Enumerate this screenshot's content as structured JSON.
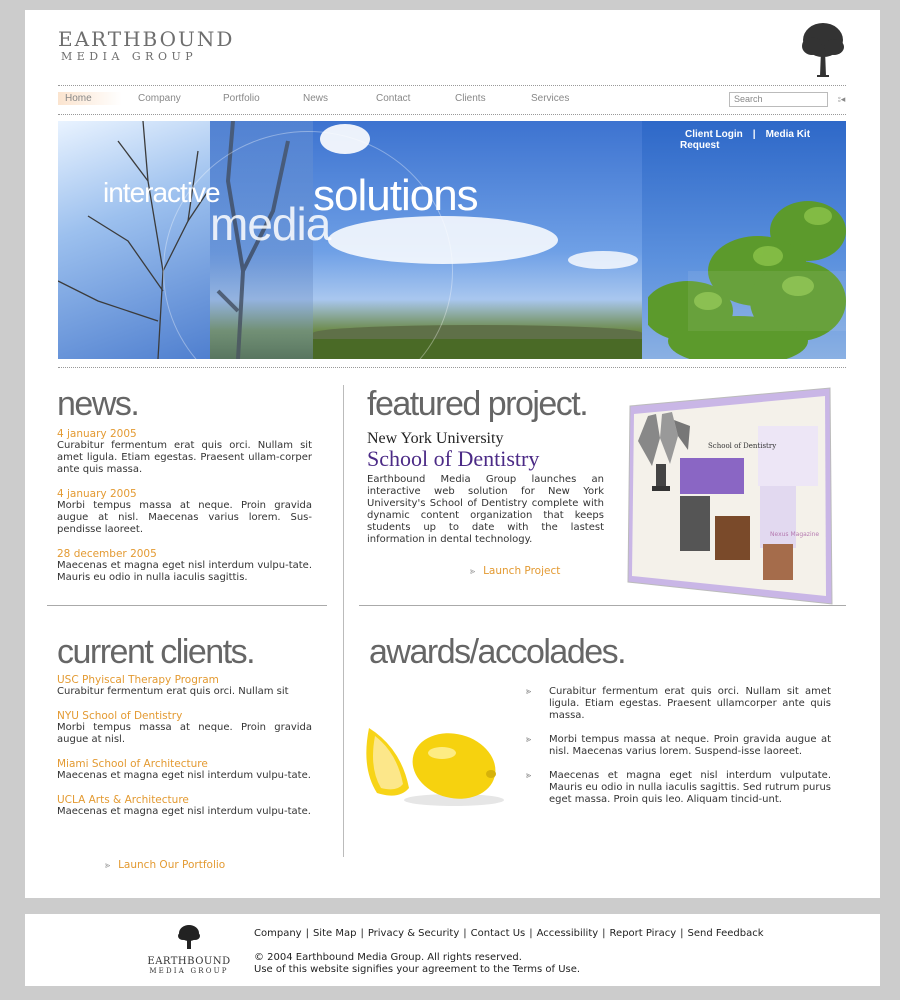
{
  "brand": {
    "line1": "EARTHBOUND",
    "line2": "MEDIA GROUP"
  },
  "nav": {
    "items": [
      "Home",
      "Company",
      "Portfolio",
      "News",
      "Contact",
      "Clients",
      "Services"
    ],
    "search_placeholder": "Search"
  },
  "hero": {
    "word1": "interactive",
    "word2": "media",
    "word3": "solutions",
    "client_login": "Client Login",
    "separator": "|",
    "media_kit": "Media Kit Request"
  },
  "news": {
    "title": "news.",
    "items": [
      {
        "date": "4 january 2005",
        "text": "Curabitur fermentum erat quis orci. Nullam sit amet ligula. Etiam egestas. Praesent ullam-corper ante quis massa."
      },
      {
        "date": "4 january 2005",
        "text": "Morbi tempus massa at neque. Proin gravida augue at nisl. Maecenas varius lorem. Sus-pendisse laoreet."
      },
      {
        "date": "28 december 2005",
        "text": "Maecenas et magna eget nisl interdum vulpu-tate. Mauris eu odio in nulla iaculis sagittis."
      }
    ]
  },
  "featured": {
    "title": "featured project.",
    "client_line1": "New York University",
    "client_line2": "School of Dentistry",
    "description": "Earthbound Media Group launches an interactive web solution for New York University's School of Dentistry complete with dynamic content organization that keeps students up to date with the lastest information in dental technology.",
    "launch": "Launch Project",
    "shot_title": "School of Dentistry",
    "shot_badge": "Nexus Magazine"
  },
  "clients": {
    "title": "current clients.",
    "items": [
      {
        "name": "USC Phyiscal Therapy Program",
        "text": "Curabitur fermentum erat quis orci. Nullam sit"
      },
      {
        "name": "NYU School of Dentistry",
        "text": "Morbi tempus massa at neque. Proin gravida augue at nisl."
      },
      {
        "name": "Miami School of Architecture",
        "text": "Maecenas et magna eget nisl interdum vulpu-tate."
      },
      {
        "name": "UCLA Arts & Architecture",
        "text": "Maecenas et magna eget nisl interdum vulpu-tate."
      }
    ],
    "launch": "Launch Our Portfolio"
  },
  "awards": {
    "title": "awards/accolades.",
    "items": [
      "Curabitur fermentum erat quis orci. Nullam sit amet ligula. Etiam egestas. Praesent ullamcorper ante quis massa.",
      "Morbi tempus massa at neque. Proin gravida augue at nisl. Maecenas varius lorem. Suspend-isse laoreet.",
      "Maecenas et magna eget nisl interdum vulputate. Mauris eu odio in nulla iaculis sagittis. Sed rutrum purus eget massa. Proin quis leo. Aliquam tincid-unt."
    ]
  },
  "footer": {
    "logo_line1": "EARTHBOUND",
    "logo_line2": "MEDIA GROUP",
    "links": [
      "Company",
      "Site Map",
      "Privacy & Security",
      "Contact Us",
      "Accessibility",
      "Report Piracy",
      "Send Feedback"
    ],
    "separator": "|",
    "copyright": "© 2004 Earthbound Media Group. All rights reserved.",
    "terms": "Use of this website signifies your agreement to the Terms of Use."
  },
  "colors": {
    "accent": "#e39a32",
    "heading": "#666666",
    "nyu_purple": "#4b2a86",
    "page_bg": "#cccccc"
  },
  "icons": [
    "tree-logo-icon",
    "search-go-icon",
    "arrow-icon"
  ]
}
